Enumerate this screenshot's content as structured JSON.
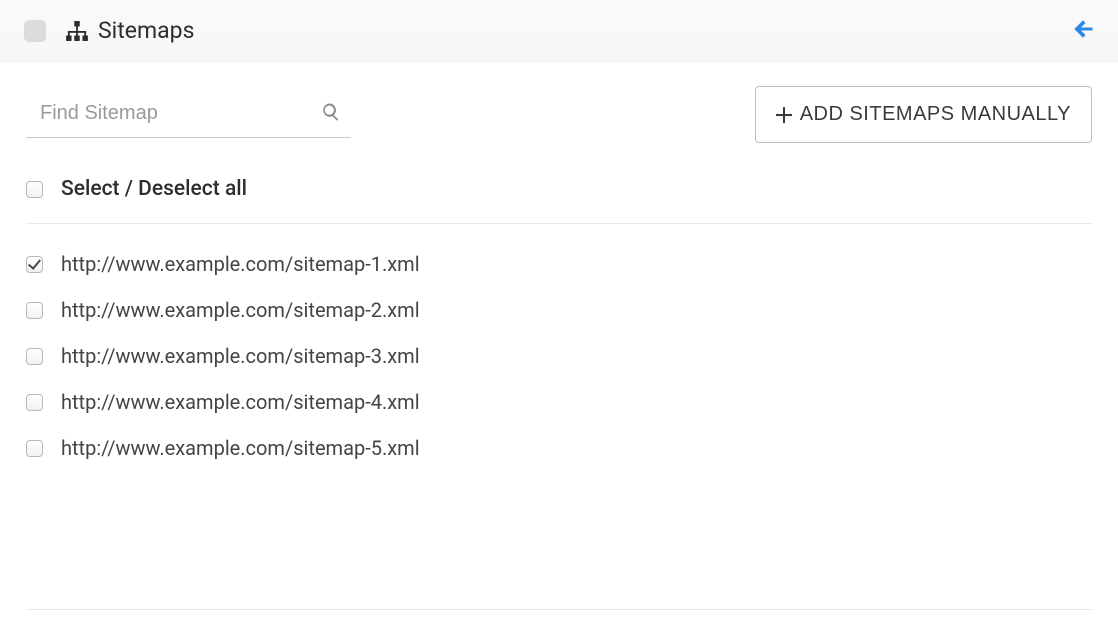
{
  "header": {
    "title": "Sitemaps"
  },
  "toolbar": {
    "search_placeholder": "Find Sitemap",
    "add_button_label": "ADD SITEMAPS MANUALLY"
  },
  "select_all": {
    "label": "Select / Deselect all",
    "checked": false
  },
  "sitemaps": [
    {
      "url": "http://www.example.com/sitemap-1.xml",
      "checked": true
    },
    {
      "url": "http://www.example.com/sitemap-2.xml",
      "checked": false
    },
    {
      "url": "http://www.example.com/sitemap-3.xml",
      "checked": false
    },
    {
      "url": "http://www.example.com/sitemap-4.xml",
      "checked": false
    },
    {
      "url": "http://www.example.com/sitemap-5.xml",
      "checked": false
    }
  ]
}
